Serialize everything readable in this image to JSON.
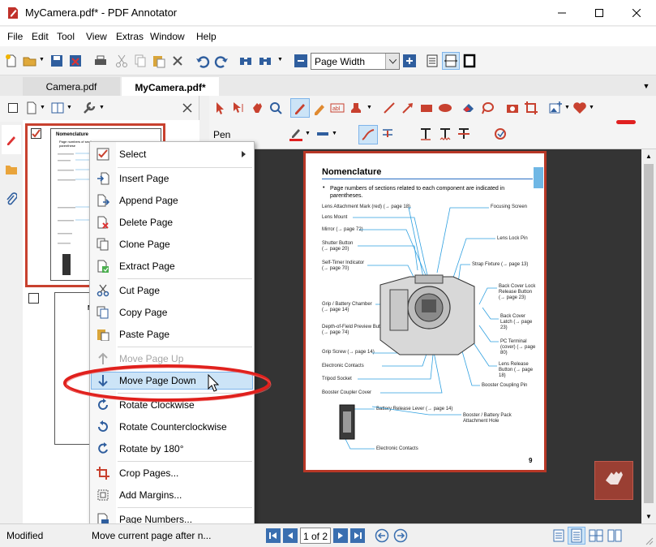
{
  "window": {
    "title": "MyCamera.pdf* - PDF Annotator"
  },
  "menu": {
    "file": "File",
    "edit": "Edit",
    "tool": "Tool",
    "view": "View",
    "extras": "Extras",
    "window": "Window",
    "help": "Help"
  },
  "toolbar": {
    "zoom_value": "Page Width"
  },
  "tabs": [
    {
      "label": "Camera.pdf"
    },
    {
      "label": "MyCamera.pdf*"
    }
  ],
  "tools": {
    "pen_label": "Pen"
  },
  "context_menu": {
    "items": [
      {
        "label": "Select"
      },
      {
        "label": "Insert Page"
      },
      {
        "label": "Append Page"
      },
      {
        "label": "Delete Page"
      },
      {
        "label": "Clone Page"
      },
      {
        "label": "Extract Page"
      },
      {
        "label": "Cut Page"
      },
      {
        "label": "Copy Page"
      },
      {
        "label": "Paste Page"
      },
      {
        "label": "Move Page Up"
      },
      {
        "label": "Move Page Down"
      },
      {
        "label": "Rotate Clockwise"
      },
      {
        "label": "Rotate Counterclockwise"
      },
      {
        "label": "Rotate by 180°"
      },
      {
        "label": "Crop Pages..."
      },
      {
        "label": "Add Margins..."
      },
      {
        "label": "Page Numbers..."
      }
    ]
  },
  "document": {
    "heading": "Nomenclature",
    "bullet": "Page numbers of sections related to each component are indicated in parentheses.",
    "left_labels": [
      "Lens Attachment Mark (red) (→ page 18)",
      "Lens Mount",
      "Mirror (→ page 72)",
      "Shutter Button (→ page 20)",
      "Self-Timer Indicator (→ page 70)",
      "Grip / Battery Chamber (→ page 14)",
      "Depth-of-Field Preview Button (→ page 74)",
      "Grip Screw (→ page 14)",
      "Electronic Contacts",
      "Tripod Socket",
      "Booster Coupler Cover"
    ],
    "right_labels": [
      "Focusing Screen",
      "Lens Lock Pin",
      "Strap Fixture (→ page 13)",
      "Back Cover Lock Release Button (→ page 23)",
      "Back Cover Latch (→ page 23)",
      "PC Terminal (cover) (→ page 80)",
      "Lens Release Button (→ page 18)",
      "Booster Coupling Pin"
    ],
    "lower_labels": [
      "Battery Release Lever (→ page 14)",
      "Booster / Battery Pack Attachment Hole",
      "Electronic Contacts"
    ],
    "page_number": "9",
    "thumb_heading": "Nomenclature",
    "thumb_bullet": "Page numbers of sectio... parenthese",
    "thumb2_letter": "M"
  },
  "status": {
    "mode": "Modified",
    "hint": "Move current page after n...",
    "page_indicator": "1 of 2"
  },
  "colors": {
    "accent_red": "#b73726",
    "highlight_blue": "#cce4f7",
    "focus_ellipse": "#e0201c"
  }
}
